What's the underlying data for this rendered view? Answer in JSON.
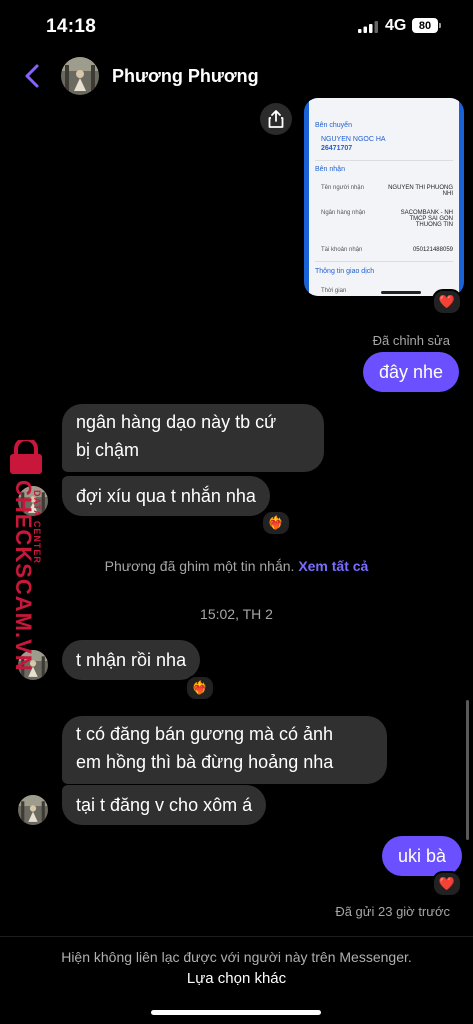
{
  "status_bar": {
    "time": "14:18",
    "network": "4G",
    "battery": "80"
  },
  "header": {
    "contact_name": "Phương Phương"
  },
  "receipt": {
    "sender_section": "Bên chuyển",
    "sender_name": "NGUYEN NGOC HA",
    "sender_account": "26471707",
    "receiver_section": "Bên nhận",
    "receiver_name_label": "Tên người nhận",
    "receiver_name": "NGUYEN THI PHUONG NHI",
    "bank_label": "Ngân hàng nhận",
    "bank_name": "SACOMBANK - NH TMCP SAI GON THUONG TIN",
    "account_label": "Tài khoản nhận",
    "account_number": "050121488059",
    "info_section": "Thông tin giao dịch",
    "time_label": "Thời gian"
  },
  "messages": {
    "edited_label": "Đã chỉnh sửa",
    "me_1": "đây nhe",
    "them_1_line1": "ngân hàng dạo này tb cứ",
    "them_1_line2": "bị chậm",
    "them_2": "đợi xíu qua t nhắn nha",
    "system_text": "Phương đã ghim một tin nhắn.",
    "system_link": "Xem tất cả",
    "timestamp": "15:02, TH 2",
    "them_3": "t nhận rồi nha",
    "them_4_line1": "t có đăng bán gương mà có ảnh",
    "them_4_line2": "em hồng thì bà đừng hoảng nha",
    "them_5": "tại t đăng v cho xôm á",
    "me_2": "uki bà",
    "sent_status": "Đã gửi 23 giờ trước"
  },
  "reactions": {
    "heart": "❤️",
    "heart_on_fire": "❤️‍🔥"
  },
  "footer": {
    "note": "Hiện không liên lạc được với người này trên Messenger.",
    "action": "Lựa chọn khác"
  },
  "watermark": {
    "text": "CHECKSCAM.VN",
    "subtext": "DATA CENTER"
  },
  "colors": {
    "accent": "#6a50ff",
    "link": "#7b6cff",
    "bubble_them": "#303030",
    "background": "#000000"
  }
}
